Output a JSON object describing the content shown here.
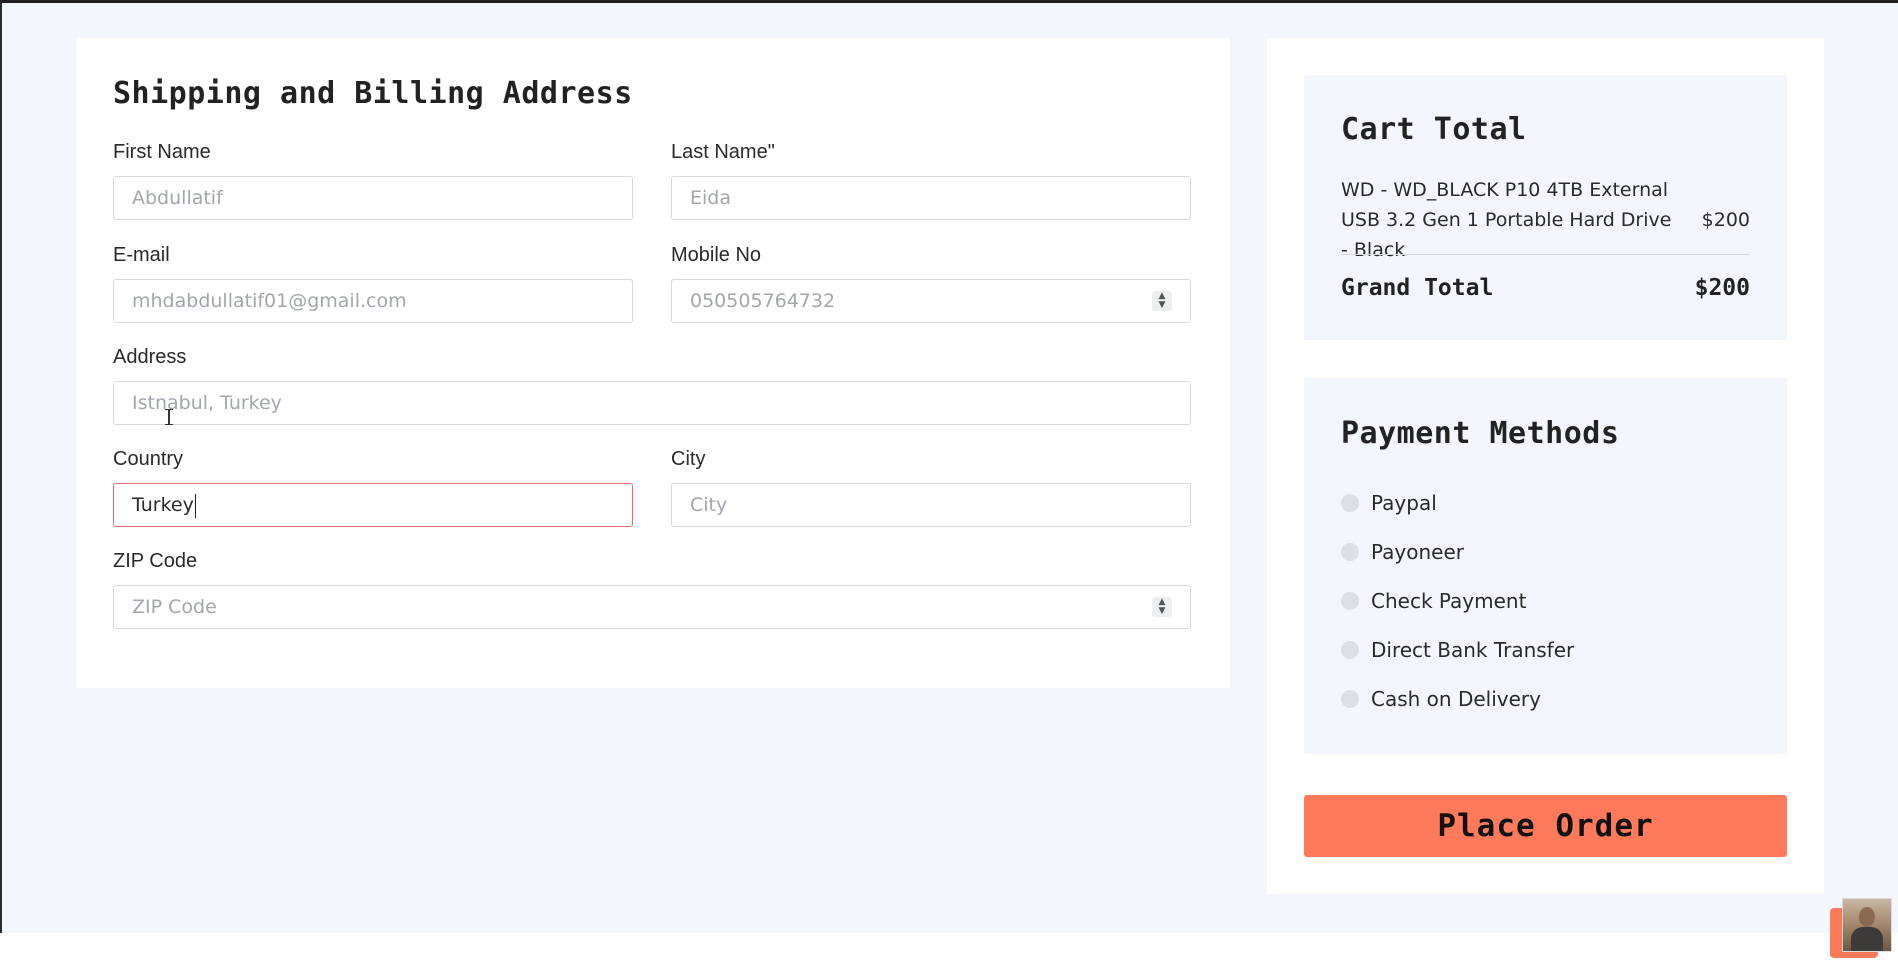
{
  "shipping": {
    "title": "Shipping and Billing Address",
    "first_name": {
      "label": "First Name",
      "placeholder": "Abdullatif"
    },
    "last_name": {
      "label": "Last Name\"",
      "placeholder": "Eida"
    },
    "email": {
      "label": "E-mail",
      "placeholder": "mhdabdullatif01@gmail.com"
    },
    "mobile": {
      "label": "Mobile No",
      "placeholder": "050505764732"
    },
    "address": {
      "label": "Address",
      "placeholder": "Istnabul, Turkey"
    },
    "country": {
      "label": "Country",
      "value": "Turkey"
    },
    "city": {
      "label": "City",
      "placeholder": "City"
    },
    "zip": {
      "label": "ZIP Code",
      "placeholder": "ZIP Code"
    }
  },
  "cart": {
    "title": "Cart Total",
    "item": {
      "name": "WD - WD_BLACK P10 4TB External USB 3.2 Gen 1 Portable Hard Drive - Black",
      "price": "$200"
    },
    "grand_total_label": "Grand Total",
    "grand_total_value": "$200"
  },
  "payment": {
    "title": "Payment Methods",
    "methods": [
      "Paypal",
      "Payoneer",
      "Check Payment",
      "Direct Bank Transfer",
      "Cash on Delivery"
    ]
  },
  "actions": {
    "place_order": "Place Order"
  },
  "colors": {
    "accent": "#ff7a5a",
    "focus_border": "#e46b6b",
    "background": "#f3f7fd"
  },
  "icons": {
    "spinner": "number-spinner-icon",
    "radio": "radio-unselected-icon"
  }
}
